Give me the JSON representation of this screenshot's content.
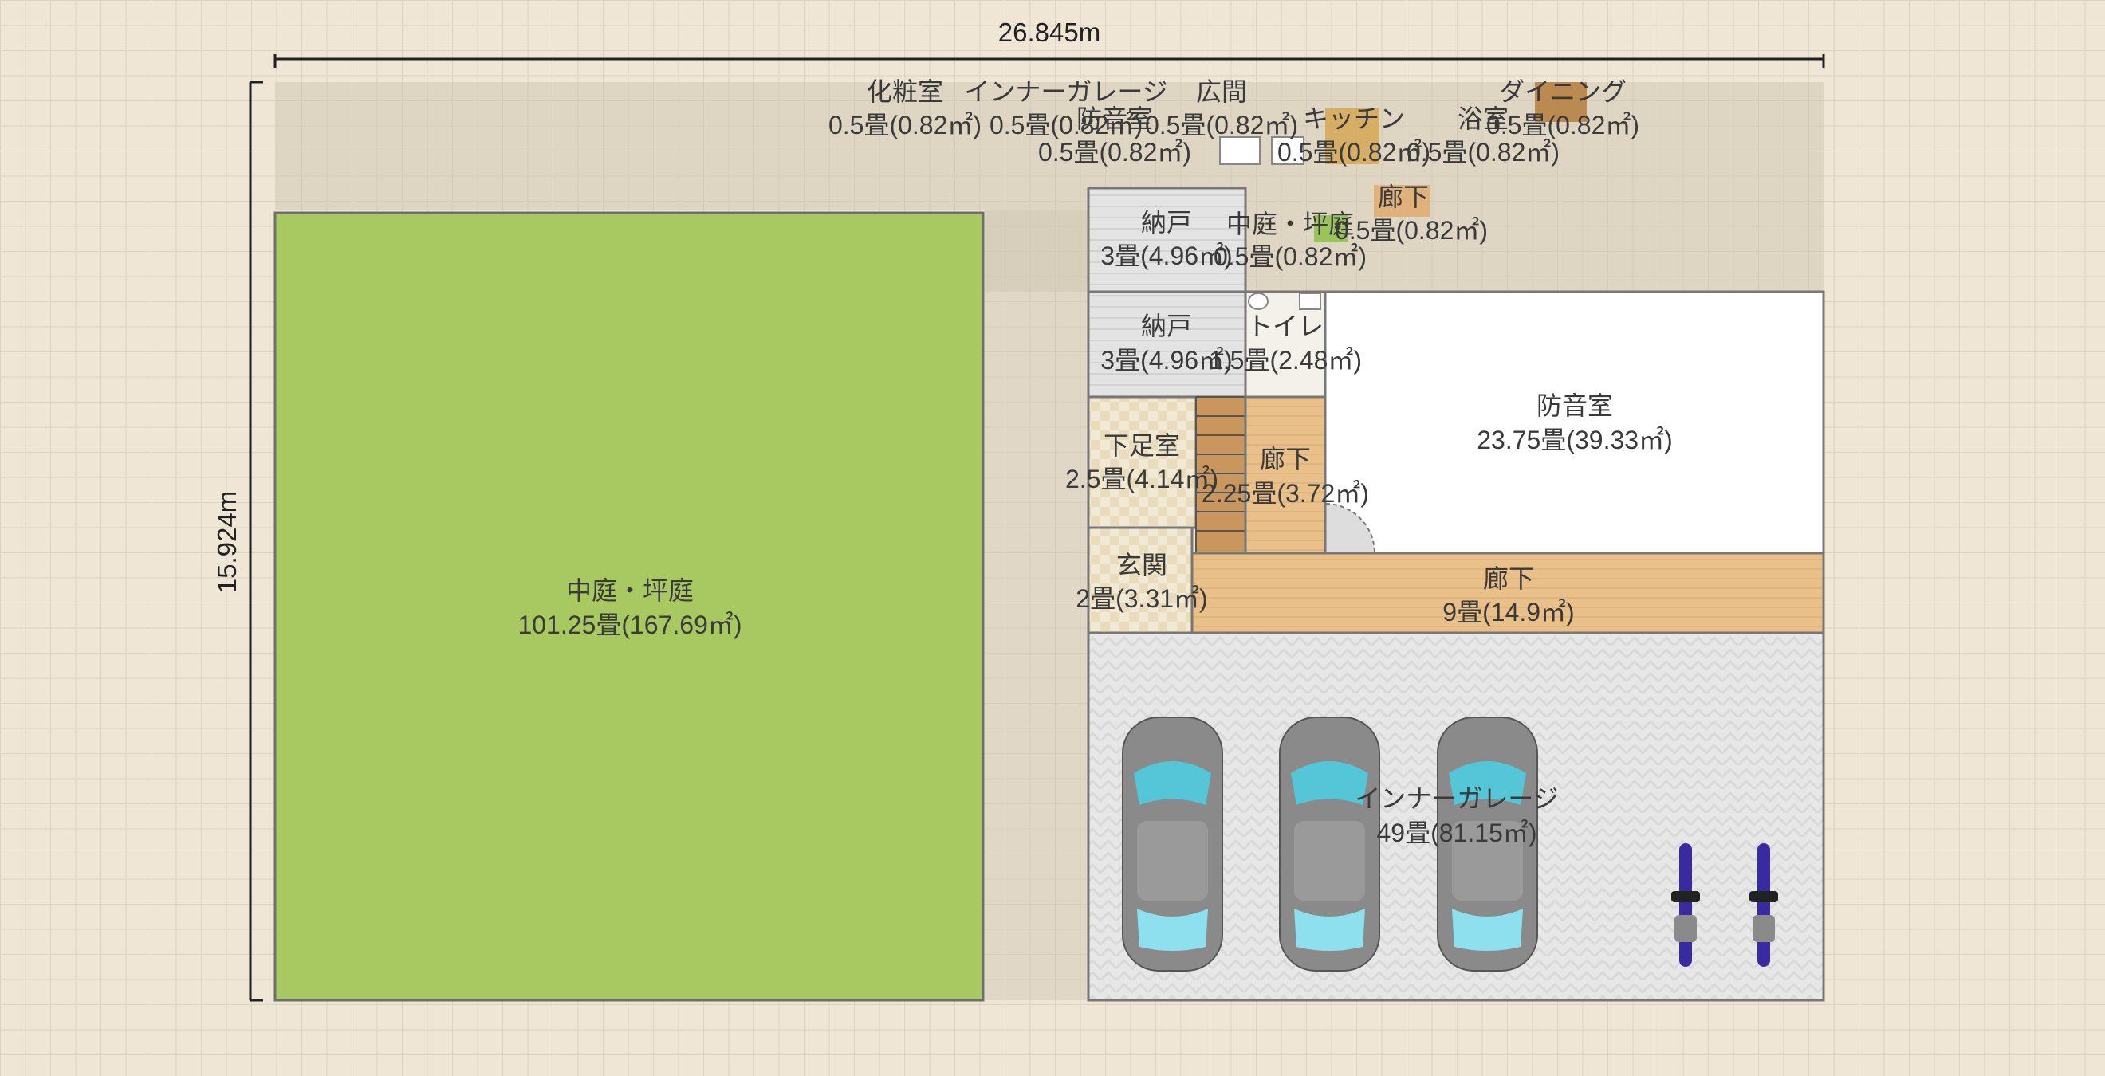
{
  "dimensions": {
    "width_label": "26.845m",
    "height_label": "15.924m"
  },
  "colors": {
    "grid_bg": "#efe6d6",
    "garden": "#a8c862",
    "wall": "#777777",
    "storage": "#e4e4e4",
    "floor_wood": "#e8be88",
    "floor_tile": "#eee5cf",
    "soundproof": "#ffffff",
    "garage": "#e6e6e6",
    "upper_band": "#cfc6b4"
  },
  "rooms": [
    {
      "id": "garden",
      "name": "中庭・坪庭",
      "area": "101.25畳(167.69㎡)"
    },
    {
      "id": "storage1",
      "name": "納戸",
      "area": "3畳(4.96㎡)"
    },
    {
      "id": "storage2",
      "name": "納戸",
      "area": "3畳(4.96㎡)"
    },
    {
      "id": "toilet",
      "name": "トイレ",
      "area": "1.5畳(2.48㎡)"
    },
    {
      "id": "shoe_room",
      "name": "下足室",
      "area": "2.5畳(4.14㎡)"
    },
    {
      "id": "hall_small",
      "name": "廊下",
      "area": "2.25畳(3.72㎡)"
    },
    {
      "id": "soundproof",
      "name": "防音室",
      "area": "23.75畳(39.33㎡)"
    },
    {
      "id": "entrance",
      "name": "玄関",
      "area": "2畳(3.31㎡)"
    },
    {
      "id": "hall_long",
      "name": "廊下",
      "area": "9畳(14.9㎡)"
    },
    {
      "id": "garage",
      "name": "インナーガレージ",
      "area": "49畳(81.15㎡)"
    },
    {
      "id": "courtyard_small",
      "name": "中庭・坪庭",
      "area": "0.5畳(0.82㎡)"
    }
  ],
  "upper_labels": [
    {
      "id": "lbl-powder",
      "name": "化粧室",
      "area": "0.5畳(0.82㎡)"
    },
    {
      "id": "lbl-garage",
      "name": "インナーガレージ",
      "area": "0.5畳(0.82㎡)"
    },
    {
      "id": "lbl-hiroma",
      "name": "広間",
      "area": "0.5畳(0.82㎡)"
    },
    {
      "id": "lbl-soundproof",
      "name": "防音室",
      "area": "0.5畳(0.82㎡)"
    },
    {
      "id": "lbl-kitchen",
      "name": "キッチン",
      "area": "0.5畳(0.82㎡)"
    },
    {
      "id": "lbl-bath",
      "name": "浴室",
      "area": "0.5畳(0.82㎡)"
    },
    {
      "id": "lbl-dining",
      "name": "ダイニング",
      "area": "0.5畳(0.82㎡)"
    },
    {
      "id": "lbl-corridor",
      "name": "廊下",
      "area": "0.5畳(0.82㎡)"
    }
  ]
}
